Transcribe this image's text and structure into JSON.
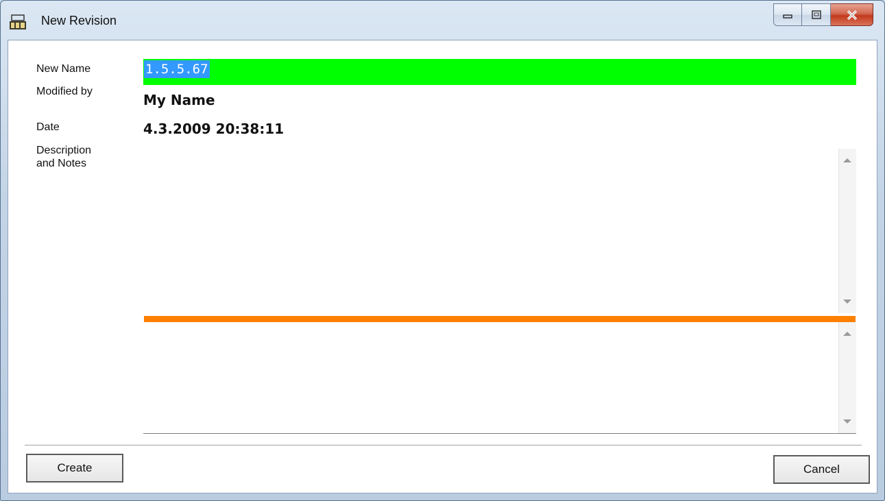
{
  "window": {
    "title": "New Revision",
    "controls": {
      "minimize": "minimize-icon",
      "maximize": "maximize-icon",
      "close": "close-icon"
    }
  },
  "form": {
    "new_name_label": "New Name",
    "new_name_value": "1.5.5.67",
    "modified_by_label": "Modified by",
    "modified_by_value": "My Name",
    "date_label": "Date",
    "date_value": "4.3.2009 20:38:11",
    "description_label_line1": "Description",
    "description_label_line2": "and Notes",
    "description_value": "",
    "notes_value": ""
  },
  "buttons": {
    "create": "Create",
    "cancel": "Cancel"
  },
  "colors": {
    "name_field_bg": "#00ff00",
    "selection": "#3399ff",
    "splitter": "#ff8000"
  }
}
